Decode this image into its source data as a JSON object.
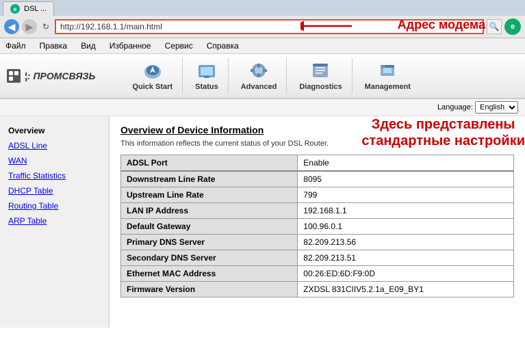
{
  "browser": {
    "back_icon": "◀",
    "forward_icon": "▶",
    "refresh_icon": "↻",
    "address": "http://192.168.1.1/main.html",
    "search_icon": "🔍",
    "tab_label": "DSL ...",
    "ie_label": "e"
  },
  "menu": {
    "items": [
      "Файл",
      "Правка",
      "Вид",
      "Избранное",
      "Сервис",
      "Справка"
    ]
  },
  "annotations": {
    "modem_label": "Адрес модема",
    "standard_line1": "Здесь представлены",
    "standard_line2": "стандартные настройки"
  },
  "router": {
    "logo_text": "¦: ПРОМСВЯЗЬ",
    "language_label": "Language:",
    "language_value": "English",
    "nav": [
      {
        "label": "Quick Start",
        "icon": "nav-quickstart"
      },
      {
        "label": "Status",
        "icon": "nav-status"
      },
      {
        "label": "Advanced",
        "icon": "nav-advanced"
      },
      {
        "label": "Diagnostics",
        "icon": "nav-diagnostics"
      },
      {
        "label": "Management",
        "icon": "nav-management"
      }
    ],
    "sidebar": [
      {
        "label": "Overview",
        "active": true
      },
      {
        "label": "ADSL Line"
      },
      {
        "label": "WAN"
      },
      {
        "label": "Traffic Statistics"
      },
      {
        "label": "DHCP Table"
      },
      {
        "label": "Routing Table"
      },
      {
        "label": "ARP Table"
      }
    ],
    "main": {
      "title": "Overview of Device Information",
      "subtitle": "This information reflects the current status of your DSL Router.",
      "table": [
        {
          "label": "ADSL Port",
          "value": "Enable",
          "group_sep": false
        },
        {
          "label": "Downstream Line Rate",
          "value": "8095",
          "group_sep": true
        },
        {
          "label": "Upstream Line Rate",
          "value": "799",
          "group_sep": false
        },
        {
          "label": "LAN IP Address",
          "value": "192.168.1.1",
          "group_sep": false
        },
        {
          "label": "Default Gateway",
          "value": "100.96.0.1",
          "group_sep": false
        },
        {
          "label": "Primary DNS Server",
          "value": "82.209.213.56",
          "group_sep": false
        },
        {
          "label": "Secondary DNS Server",
          "value": "82.209.213.51",
          "group_sep": false
        },
        {
          "label": "Ethernet MAC Address",
          "value": "00:26:ED:6D:F9:0D",
          "group_sep": false
        },
        {
          "label": "Firmware Version",
          "value": "ZXDSL 831CIIV5.2.1a_E09_BY1",
          "group_sep": false
        }
      ]
    }
  }
}
